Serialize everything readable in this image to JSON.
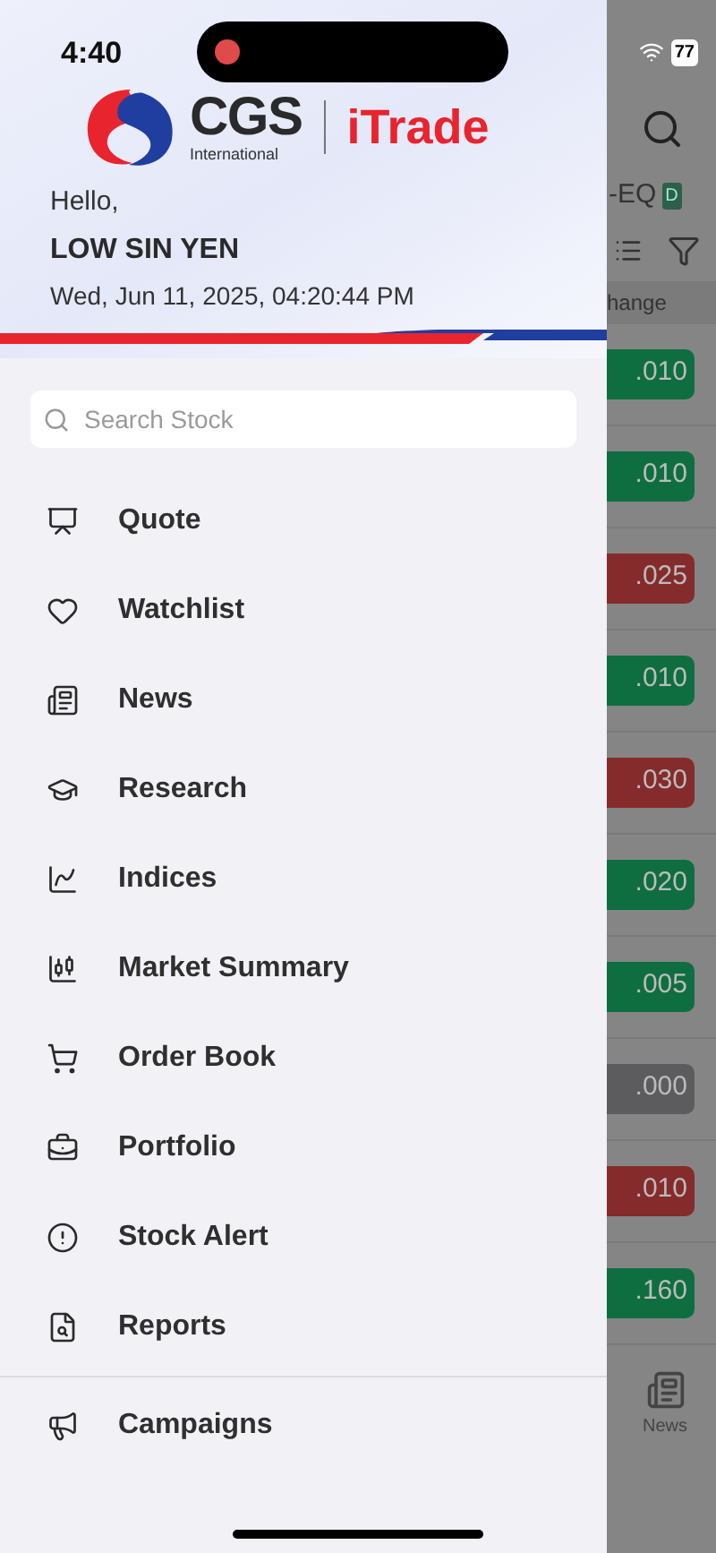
{
  "status_bar": {
    "time": "4:40",
    "battery": "77",
    "recording": true
  },
  "header": {
    "brand": "CGS",
    "brand_sub": "International",
    "product": "iTrade",
    "greeting": "Hello,",
    "user_name": "LOW SIN YEN",
    "datetime": "Wed, Jun 11, 2025, 04:20:44 PM"
  },
  "search": {
    "placeholder": "Search Stock"
  },
  "menu": [
    {
      "label": "Quote"
    },
    {
      "label": "Watchlist"
    },
    {
      "label": "News"
    },
    {
      "label": "Research"
    },
    {
      "label": "Indices"
    },
    {
      "label": "Market Summary"
    },
    {
      "label": "Order Book"
    },
    {
      "label": "Portfolio"
    },
    {
      "label": "Stock Alert"
    },
    {
      "label": "Reports"
    },
    {
      "label": "Campaigns"
    }
  ],
  "background_screen": {
    "board": "-EQ",
    "board_badge": "D",
    "column_heading": "hange",
    "changes": [
      {
        "value": ".010",
        "color": "#0f6e3f"
      },
      {
        "value": ".010",
        "color": "#0f6e3f"
      },
      {
        "value": ".025",
        "color": "#862b2b"
      },
      {
        "value": ".010",
        "color": "#0f6e3f"
      },
      {
        "value": ".030",
        "color": "#862b2b"
      },
      {
        "value": ".020",
        "color": "#0f6e3f"
      },
      {
        "value": ".005",
        "color": "#0f6e3f"
      },
      {
        "value": ".000",
        "color": "#5c5c5e"
      },
      {
        "value": ".010",
        "color": "#862b2b"
      },
      {
        "value": ".160",
        "color": "#0f6e3f"
      }
    ],
    "nav_label": "News"
  }
}
